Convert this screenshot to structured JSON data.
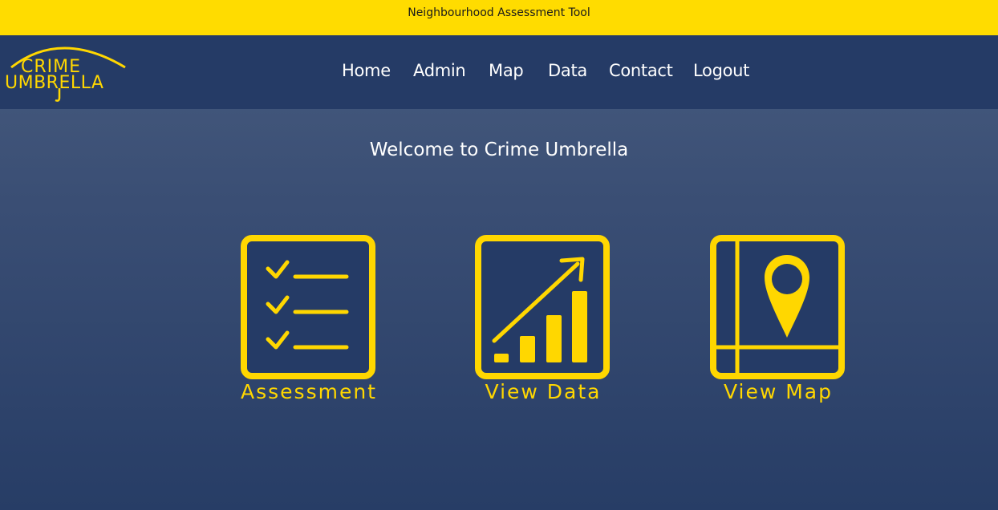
{
  "header": {
    "tagline": "Neighbourhood Assessment Tool"
  },
  "logo": {
    "line1": "CRIME",
    "line2": "UMBRELLA",
    "icon": "umbrella-logo"
  },
  "nav": {
    "items": [
      {
        "label": "Home"
      },
      {
        "label": "Admin"
      },
      {
        "label": "Map"
      },
      {
        "label": "Data"
      },
      {
        "label": "Contact"
      },
      {
        "label": "Logout"
      }
    ]
  },
  "main": {
    "welcome": "Welcome to Crime Umbrella",
    "tiles": [
      {
        "label": "Assessment",
        "icon": "checklist-icon"
      },
      {
        "label": "View Data",
        "icon": "growth-chart-icon"
      },
      {
        "label": "View Map",
        "icon": "map-pin-icon"
      }
    ]
  },
  "colors": {
    "accent": "#ffdc00",
    "navbar": "#253b66",
    "background_top": "#485d80",
    "background_bottom": "#273d66",
    "icon_fill": "#ffd700"
  }
}
